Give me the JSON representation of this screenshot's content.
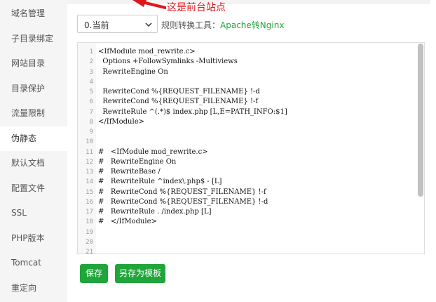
{
  "sidebar": {
    "items": [
      {
        "label": "域名管理",
        "active": false
      },
      {
        "label": "子目录绑定",
        "active": false
      },
      {
        "label": "网站目录",
        "active": false
      },
      {
        "label": "目录保护",
        "active": false
      },
      {
        "label": "流量限制",
        "active": false
      },
      {
        "label": "伪静态",
        "active": true
      },
      {
        "label": "默认文档",
        "active": false
      },
      {
        "label": "配置文件",
        "active": false
      },
      {
        "label": "SSL",
        "active": false
      },
      {
        "label": "PHP版本",
        "active": false
      },
      {
        "label": "Tomcat",
        "active": false
      },
      {
        "label": "重定向",
        "active": false
      }
    ]
  },
  "toolbar": {
    "select_value": "0.当前",
    "rule_label_prefix": "规则转换工具：",
    "rule_label_link": "Apache转Nginx"
  },
  "annotation": {
    "text": "这是前台站点",
    "color": "#e0151b"
  },
  "editor": {
    "lines": [
      "<IfModule mod_rewrite.c>",
      "  Options +FollowSymlinks -Multiviews",
      "  RewriteEngine On",
      "",
      "  RewriteCond %{REQUEST_FILENAME} !-d",
      "  RewriteCond %{REQUEST_FILENAME} !-f",
      "  RewriteRule ^(.*)$ index.php [L,E=PATH_INFO:$1]",
      "</IfModule>",
      "",
      "",
      "#   <IfModule mod_rewrite.c>",
      "#   RewriteEngine On",
      "#   RewriteBase /",
      "#   RewriteRule ^index\\.php$ - [L]",
      "#   RewriteCond %{REQUEST_FILENAME} !-f",
      "#   RewriteCond %{REQUEST_FILENAME} !-d",
      "#   RewriteRule . /index.php [L]",
      "#   </IfModule>",
      "",
      "",
      ""
    ]
  },
  "buttons": {
    "save": "保存",
    "save_as_template": "另存为模板"
  },
  "colors": {
    "accent_green": "#20a53a",
    "sidebar_bg": "#f5f5f5"
  }
}
